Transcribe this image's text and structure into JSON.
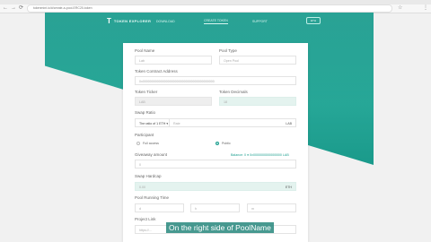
{
  "browser": {
    "url": "tokenmint.io/#/create-a-pool-ERC20-token",
    "nav": {
      "back": "←",
      "forward": "→",
      "reload": "⟳"
    },
    "star": "☆",
    "menu": "⋮"
  },
  "header": {
    "logo_mark": "T",
    "logo_text": "TOKEN EXPLORER",
    "links": [
      "DOWNLOAD",
      "CREATE TOKEN",
      "SUPPORT"
    ],
    "network": "ETH"
  },
  "form": {
    "pool_name": {
      "label": "Pool Name",
      "value": "Lab"
    },
    "pool_type": {
      "label": "Pool Type",
      "value": "Open Pool"
    },
    "token_contract": {
      "label": "Token Contract Address",
      "value": "0x0000000000000000000000000000000000000000"
    },
    "token_ticker": {
      "label": "Token Ticker",
      "value": "LAB"
    },
    "token_decimals": {
      "label": "Token Decimals",
      "value": "18"
    },
    "swap_ratio": {
      "label": "Swap Ratio",
      "prefix": "The ratio of 1 ETH ▾",
      "placeholder": "Rate",
      "unit": "LAB"
    },
    "participant": {
      "label": "Participant",
      "options": [
        "Full access",
        "Public"
      ]
    },
    "giveaway": {
      "label": "Giveaway amount",
      "link": "Balance: 0 ● 0x0000000000000000 LAB",
      "placeholder": "0"
    },
    "swap_hardcap": {
      "label": "Swap Hardcap",
      "value": "0.00",
      "unit": "ETH"
    },
    "pool_running_time": {
      "label": "Pool Running Time",
      "fields": [
        "d",
        "h",
        "m"
      ]
    },
    "project_link": {
      "label": "Project Link",
      "placeholder": "https://..."
    }
  },
  "caption": "On the right side of PoolName"
}
